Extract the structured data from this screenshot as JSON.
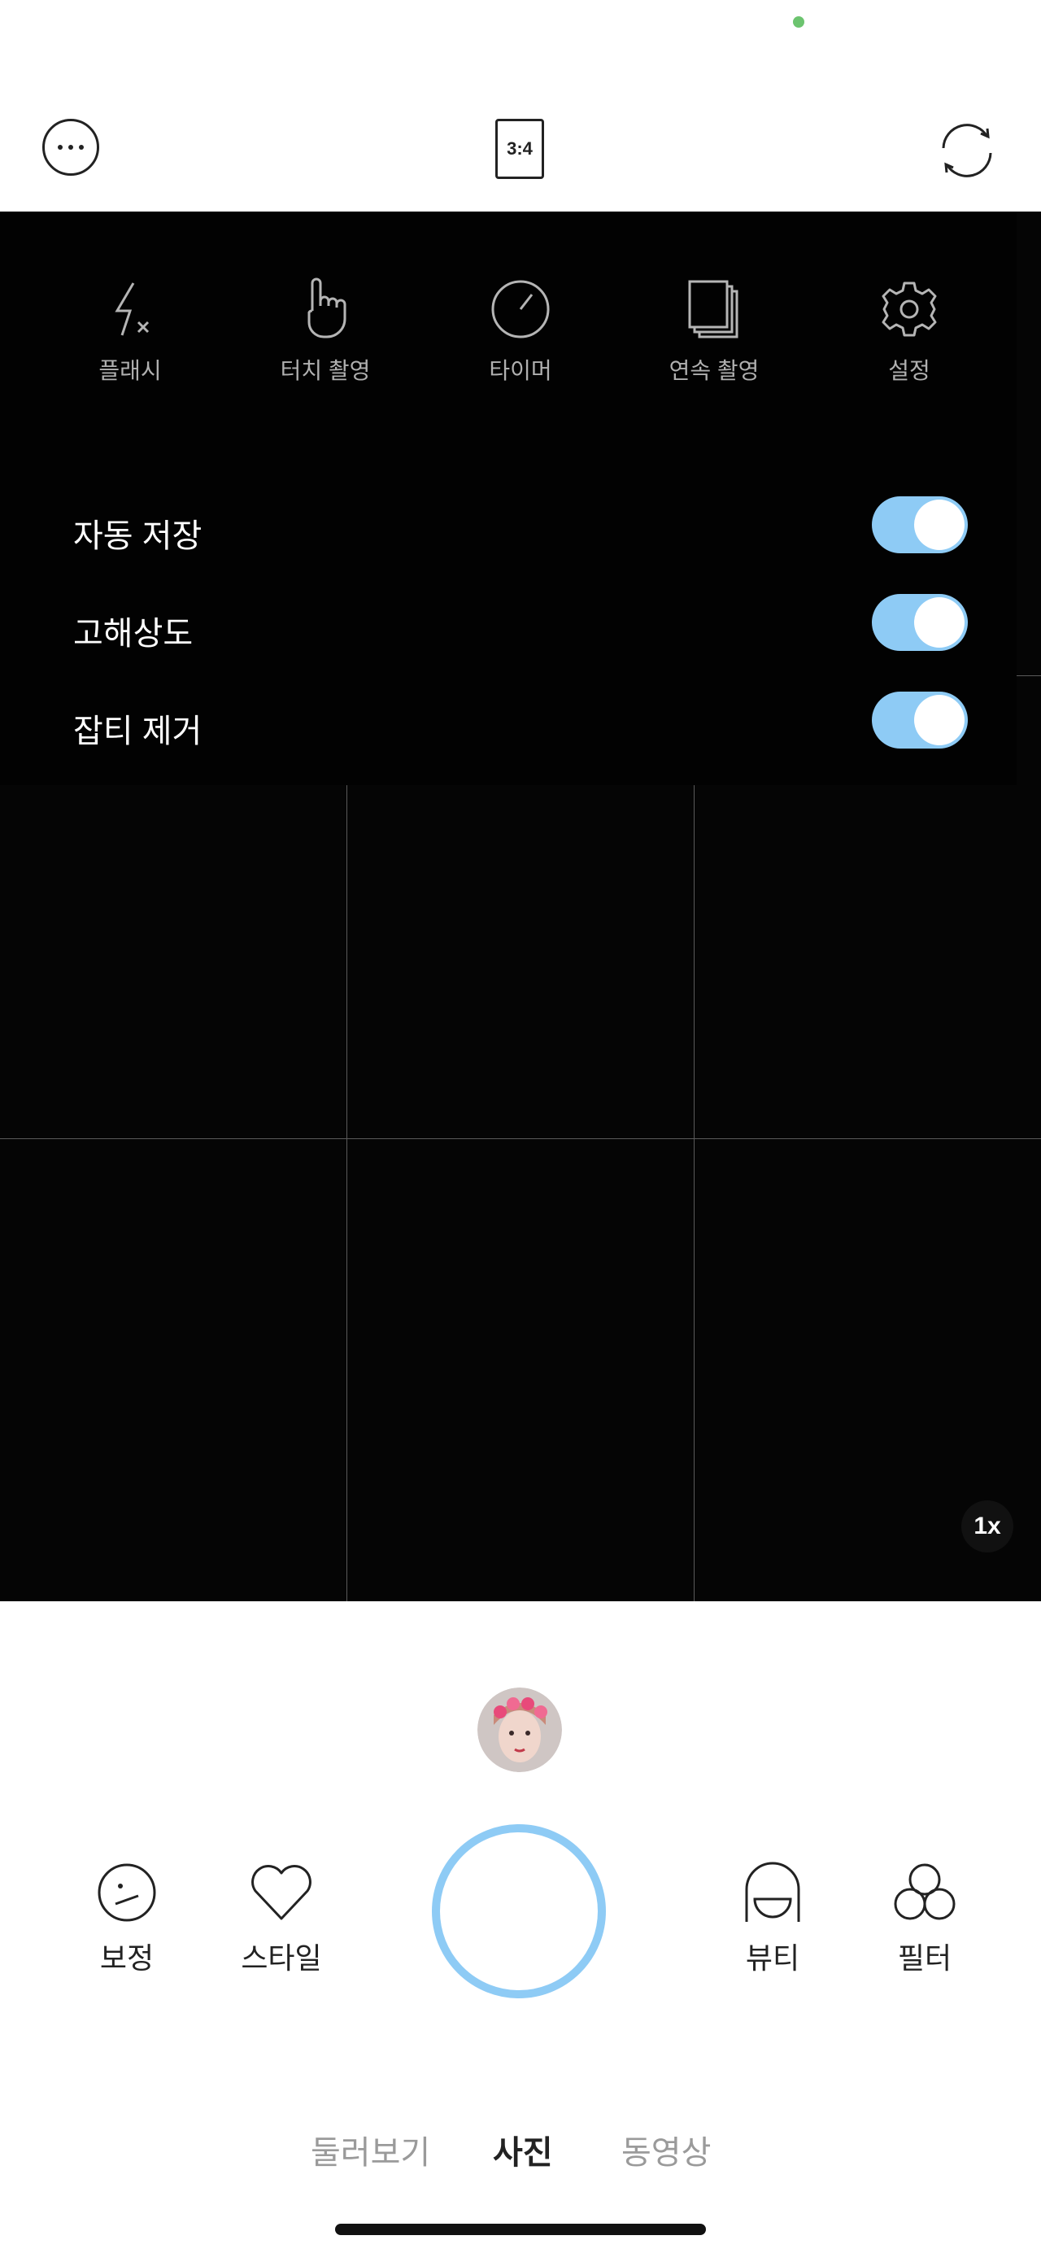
{
  "top_bar": {
    "more_icon": "more-dots-icon",
    "ratio_label": "3:4",
    "flip_icon": "camera-flip-icon"
  },
  "quick_settings": [
    {
      "icon": "flash-off-icon",
      "label": "플래시"
    },
    {
      "icon": "touch-hand-icon",
      "label": "터치 촬영"
    },
    {
      "icon": "timer-icon",
      "label": "타이머"
    },
    {
      "icon": "burst-stack-icon",
      "label": "연속 촬영"
    },
    {
      "icon": "gear-icon",
      "label": "설정"
    }
  ],
  "toggles": [
    {
      "label": "자동 저장",
      "on": true
    },
    {
      "label": "고해상도",
      "on": true
    },
    {
      "label": "잡티 제거",
      "on": true
    }
  ],
  "viewfinder": {
    "zoom_label": "1x"
  },
  "tools_left": [
    {
      "icon": "retouch-face-icon",
      "label": "보정"
    },
    {
      "icon": "heart-icon",
      "label": "스타일"
    }
  ],
  "tools_right": [
    {
      "icon": "beauty-hair-icon",
      "label": "뷰티"
    },
    {
      "icon": "filter-circles-icon",
      "label": "필터"
    }
  ],
  "modes": [
    {
      "label": "둘러보기",
      "active": false
    },
    {
      "label": "사진",
      "active": true
    },
    {
      "label": "동영상",
      "active": false
    }
  ],
  "colors": {
    "accent": "#8ecbf5",
    "viewfinder_bg": "#050505",
    "status_dot": "#6cc46f"
  }
}
